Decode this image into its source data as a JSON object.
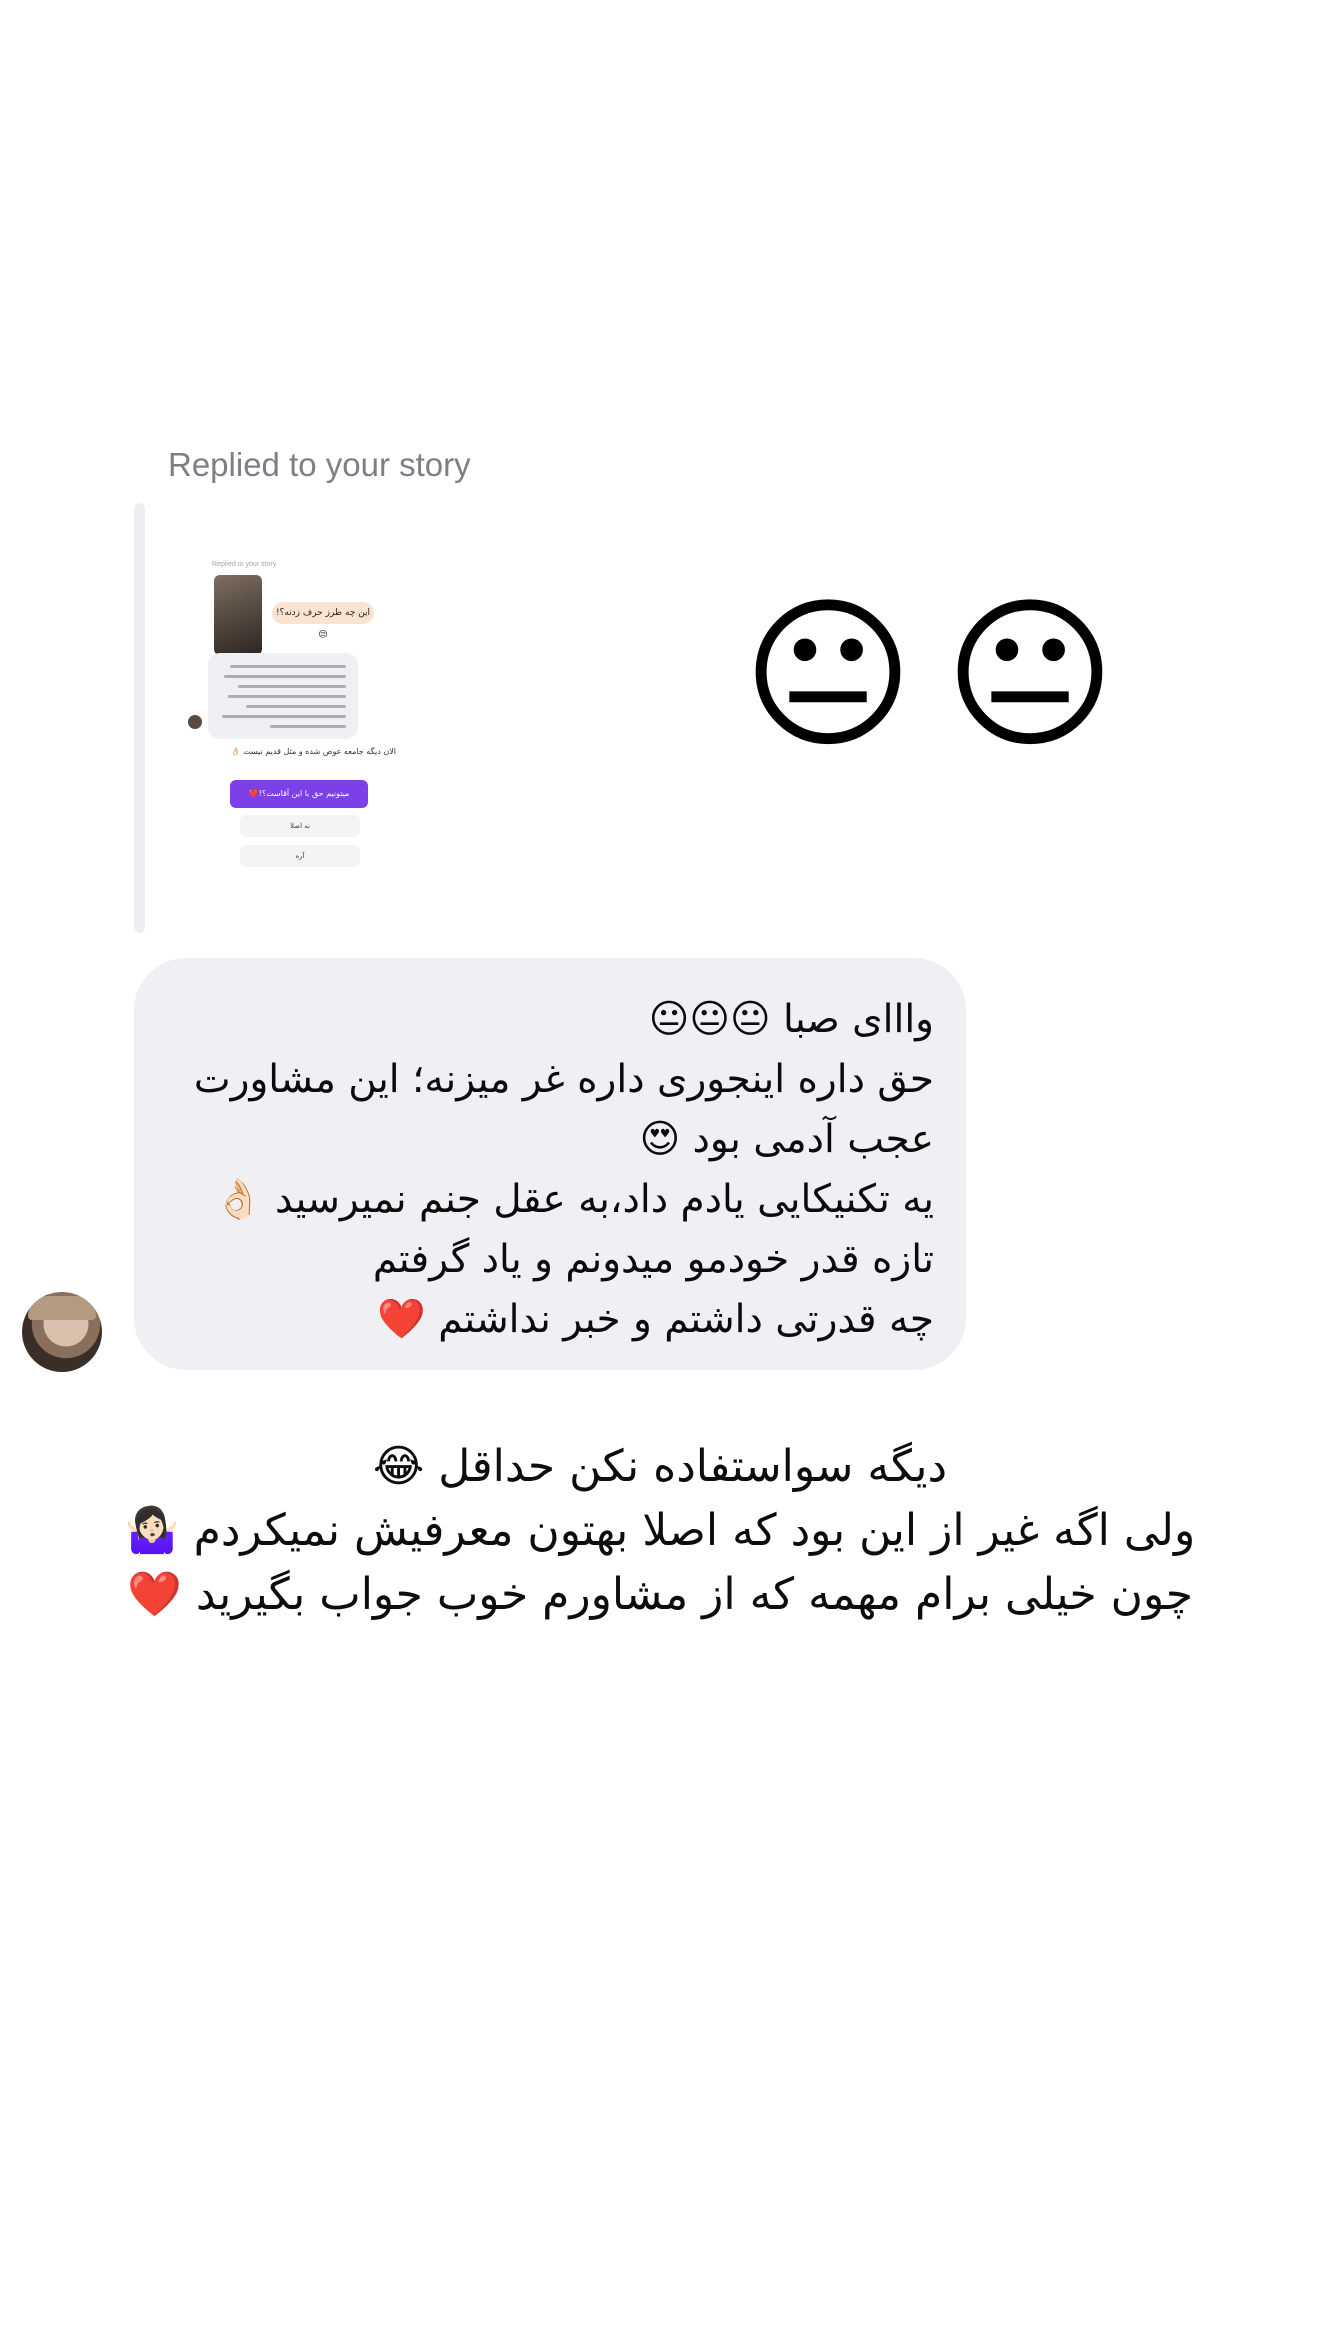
{
  "story_reply": {
    "caption": "Replied to your story",
    "screenshot": {
      "caption": "Replied to your story",
      "peach_bubble": "این چه طرز حرف زدنه؟!😒",
      "bottom_text": "الان دیگه جامعه عوض شده و مثل قدیم نیست 👌🏻",
      "button": "میتونیم حق با این آقاست؟!❤️",
      "option_1": "نه اصلا",
      "option_2": "آره"
    },
    "reaction_emojis": [
      "😐",
      "😐"
    ]
  },
  "message": {
    "lines": [
      "وااای صبا 😐😐😐",
      "حق داره اینجوری داره غر میزنه؛ این مشاورت",
      "عجب آدمی بود 😍",
      "یه تکنیکایی یادم داد،به عقل جنم نمیرسید 👌🏻",
      "تازه قدر خودمو میدونم و یاد گرفتم",
      "چه قدرتی داشتم و خبر نداشتم ❤️"
    ]
  },
  "caption": {
    "lines": [
      "دیگه سواستفاده نکن حداقل 😂",
      "ولی اگه غیر از این بود که اصلا بهتون معرفیش نمیکردم 🤷🏻‍♀️",
      "چون خیلی برام مهمه که از مشاورم خوب جواب بگیرید ❤️"
    ]
  }
}
